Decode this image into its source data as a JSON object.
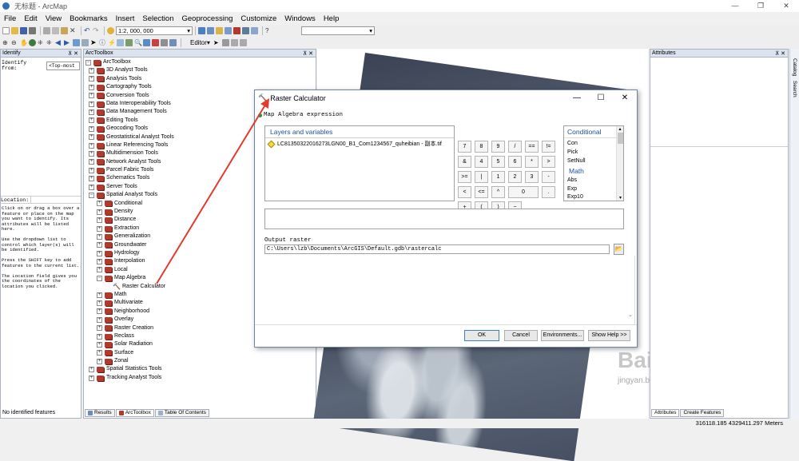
{
  "window": {
    "title": "无标题 - ArcMap",
    "minimize": "—",
    "maximize": "❐",
    "close": "✕"
  },
  "menu": [
    "File",
    "Edit",
    "View",
    "Bookmarks",
    "Insert",
    "Selection",
    "Geoprocessing",
    "Customize",
    "Windows",
    "Help"
  ],
  "toolbar": {
    "scale": "1:2, 000, 000",
    "editor": "Editor▾"
  },
  "identify": {
    "title": "Identify",
    "identify_from_label": "Identify from:",
    "identify_from_value": "<Top-most",
    "location_label": "Location:",
    "help_text": "Click on or drag a box over a feature or place on the map you want to identify. Its attributes will be listed here.\n\nUse the dropdown list to control which layer(s) will be identified.\n\nPress the SHIFT key to add features to the current list.\n\nThe Location field gives you the coordinates of the location you clicked.",
    "status": "No identified features"
  },
  "arctoolbox": {
    "title": "ArcToolbox",
    "root": "ArcToolbox",
    "toolboxes": [
      "3D Analyst Tools",
      "Analysis Tools",
      "Cartography Tools",
      "Conversion Tools",
      "Data Interoperability Tools",
      "Data Management Tools",
      "Editing Tools",
      "Geocoding Tools",
      "Geostatistical Analyst Tools",
      "Linear Referencing Tools",
      "Multidimension Tools",
      "Network Analyst Tools",
      "Parcel Fabric Tools",
      "Schematics Tools",
      "Server Tools"
    ],
    "spatial_analyst": "Spatial Analyst Tools",
    "sa_before": [
      "Conditional",
      "Density",
      "Distance",
      "Extraction",
      "Generalization",
      "Groundwater",
      "Hydrology",
      "Interpolation",
      "Local"
    ],
    "map_algebra": "Map Algebra",
    "raster_calculator": "Raster Calculator",
    "sa_after": [
      "Math",
      "Multivariate",
      "Neighborhood",
      "Overlay",
      "Raster Creation",
      "Reclass",
      "Solar Radiation",
      "Surface",
      "Zonal"
    ],
    "toolboxes_after": [
      "Spatial Statistics Tools",
      "Tracking Analyst Tools"
    ],
    "tabs": [
      "Results",
      "ArcToolbox",
      "Table Of Contents"
    ]
  },
  "attributes": {
    "title": "Attributes",
    "tabs": [
      "Attributes",
      "Create Features"
    ],
    "side_tabs": [
      "Catalog",
      "Search"
    ]
  },
  "dialog": {
    "title": "Raster Calculator",
    "section": "Map Algebra expression",
    "layers_header": "Layers and variables",
    "layer_item": "LC81350322016273LGN00_B1_Com1234567_quheibian - 副本.tif",
    "calc_buttons": [
      "7",
      "8",
      "9",
      "/",
      "==",
      "!=",
      "&",
      "4",
      "5",
      "6",
      "*",
      ">",
      ">=",
      "|",
      "1",
      "2",
      "3",
      "-",
      "<",
      "<=",
      "^",
      "0",
      ".",
      "+",
      "(",
      ")",
      "~"
    ],
    "func_header1": "Conditional",
    "funcs1": [
      "Con",
      "Pick",
      "SetNull"
    ],
    "func_header2": "Math",
    "funcs2": [
      "Abs",
      "Exp",
      "Exp10"
    ],
    "output_label": "Output raster",
    "output_value": "C:\\Users\\lzb\\Documents\\ArcGIS\\Default.gdb\\rastercalc",
    "buttons": {
      "ok": "OK",
      "cancel": "Cancel",
      "environments": "Environments...",
      "help": "Show Help >>"
    }
  },
  "status": {
    "coords": "316118.185  4329411.297 Meters"
  },
  "watermark": {
    "text": "Baidu经验",
    "url": "jingyan.baidu.com"
  }
}
